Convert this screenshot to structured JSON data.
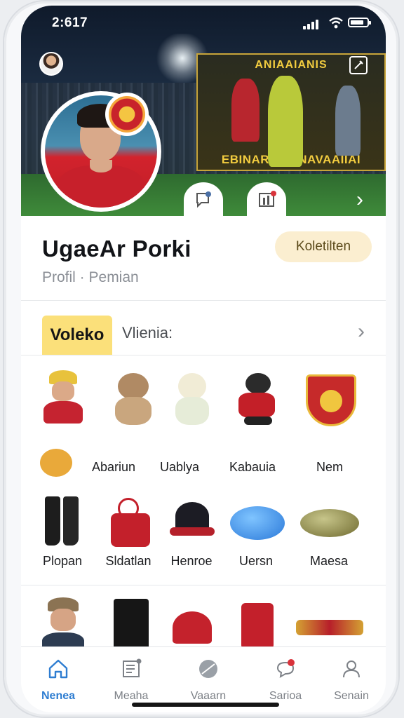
{
  "status_bar": {
    "time": "2:617"
  },
  "hero": {
    "banner_top": "ANIAAIANIS",
    "banner_bottom": "EBINARIIDU NAVAAIIAI"
  },
  "profile": {
    "name": "UgaeAr Porki",
    "subtitle": "Profil · Pemian",
    "follow_button": "Koletilten"
  },
  "tabs": {
    "active": "Voleko",
    "other": "Vlienia:"
  },
  "items_row1": [
    {
      "label": "",
      "icon": "player-cap-figure"
    },
    {
      "label": "",
      "icon": "teddy-bear"
    },
    {
      "label": "",
      "icon": "plush-toy"
    },
    {
      "label": "",
      "icon": "mascot-figure"
    },
    {
      "label": "",
      "icon": "club-crest"
    }
  ],
  "items_row1_labels": [
    "Abariun",
    "Uablya",
    "Kabauia",
    "Nem"
  ],
  "items_row2": [
    {
      "label": "Plopan",
      "icon": "boots"
    },
    {
      "label": "Sldatlan",
      "icon": "red-bag"
    },
    {
      "label": "Henroe",
      "icon": "cap"
    },
    {
      "label": "Uersn",
      "icon": "blue-ball"
    },
    {
      "label": "Maesa",
      "icon": "brass-item"
    }
  ],
  "items_row3": [
    {
      "icon": "player-figure"
    },
    {
      "icon": "black-boot"
    },
    {
      "icon": "red-cap"
    },
    {
      "icon": "red-box"
    },
    {
      "icon": "bottle"
    }
  ],
  "nav": [
    {
      "label": "Nenea",
      "icon": "home-icon",
      "active": true
    },
    {
      "label": "Meaha",
      "icon": "news-icon",
      "active": false
    },
    {
      "label": "Vaaarn",
      "icon": "ball-icon",
      "active": false
    },
    {
      "label": "Sarioa",
      "icon": "chat-icon",
      "active": false
    },
    {
      "label": "Senain",
      "icon": "profile-icon",
      "active": false
    }
  ],
  "colors": {
    "accent": "#2e7dd1",
    "tab_highlight": "#fbe07a",
    "follow_bg": "#fbeed0"
  }
}
